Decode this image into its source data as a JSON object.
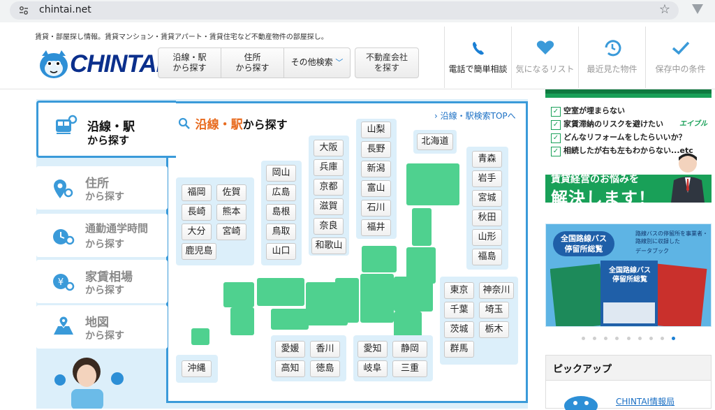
{
  "browser": {
    "url": "chintai.net"
  },
  "header": {
    "tagline": "賃貸・部屋探し情報。賃貸マンション・賃貸アパート・賃貸住宅など不動産物件の部屋探し。",
    "logo_text": "CHINTAI",
    "search_buttons": [
      {
        "line1": "沿線・駅",
        "line2": "から探す"
      },
      {
        "line1": "住所",
        "line2": "から探す"
      },
      {
        "line1": "その他検索",
        "line2": ""
      }
    ],
    "agent_button": {
      "line1": "不動産会社",
      "line2": "を探す"
    },
    "nav": [
      {
        "label": "電話で簡単相談",
        "icon": "phone-icon"
      },
      {
        "label": "気になるリスト",
        "icon": "heart-icon"
      },
      {
        "label": "最近見た物件",
        "icon": "history-icon"
      },
      {
        "label": "保存中の条件",
        "icon": "check-icon"
      }
    ]
  },
  "side_tabs": [
    {
      "line1": "沿線・駅",
      "line2": "から探す",
      "icon": "train-search-icon"
    },
    {
      "line1": "住所",
      "line2": "から探す",
      "icon": "map-pin-icon"
    },
    {
      "line1": "通勤通学時間",
      "line2": "から探す",
      "icon": "clock-search-icon"
    },
    {
      "line1": "家賃相場",
      "line2": "から探す",
      "icon": "yen-pin-icon"
    },
    {
      "line1": "地図",
      "line2": "から探す",
      "icon": "map-icon"
    }
  ],
  "panel": {
    "title_accent": "沿線・駅",
    "title_rest": "から探す",
    "top_link": "沿線・駅検索TOPへ"
  },
  "regions": {
    "kyushu": [
      "福岡",
      "佐賀",
      "長崎",
      "熊本",
      "大分",
      "宮崎",
      "鹿児島"
    ],
    "okinawa": [
      "沖縄"
    ],
    "chugoku": [
      "岡山",
      "広島",
      "島根",
      "鳥取",
      "山口"
    ],
    "kinki": [
      "大阪",
      "兵庫",
      "京都",
      "滋賀",
      "奈良",
      "和歌山"
    ],
    "koshinetsu": [
      "山梨",
      "長野",
      "新潟",
      "富山",
      "石川",
      "福井"
    ],
    "hokkaido": [
      "北海道"
    ],
    "tohoku": [
      "青森",
      "岩手",
      "宮城",
      "秋田",
      "山形",
      "福島"
    ],
    "kanto": [
      "東京",
      "神奈川",
      "千葉",
      "埼玉",
      "茨城",
      "栃木",
      "群馬"
    ],
    "shikoku": [
      "愛媛",
      "香川",
      "高知",
      "徳島"
    ],
    "tokai": [
      "愛知",
      "静岡",
      "岐阜",
      "三重"
    ]
  },
  "ad_owner": {
    "checklist": [
      "空室が埋まらない",
      "家賃滞納のリスクを避けたい",
      "どんなリフォームをしたらいいか？",
      "相続したが右も左もわからない...etc"
    ],
    "brand": "エイブル",
    "subtitle": "賃貸経営のお悩みを",
    "headline": "解決します！"
  },
  "ad_bus": {
    "pill_line1": "全国路線バス",
    "pill_line2": "停留所総覧",
    "desc": "路線バスの停留所を事業者・路線別に収録した",
    "desc2": "データブック",
    "book_title_1": "全国路線バス",
    "book_title_2": "停留所総覧"
  },
  "pickup": {
    "heading": "ピックアップ",
    "link": "CHINTAI情報局"
  }
}
